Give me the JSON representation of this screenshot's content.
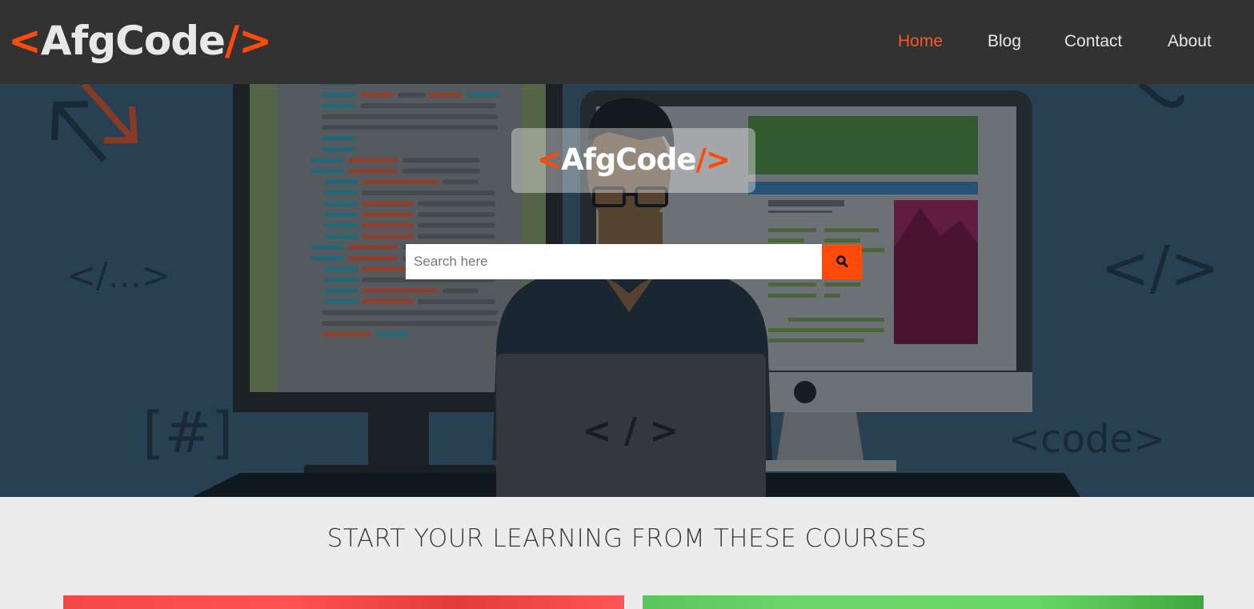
{
  "brand": {
    "open": "<",
    "name": "AfgCode",
    "close": "/>",
    "accent_color": "#ff4a0a"
  },
  "nav": {
    "items": [
      {
        "label": "Home",
        "active": true
      },
      {
        "label": "Blog",
        "active": false
      },
      {
        "label": "Contact",
        "active": false
      },
      {
        "label": "About",
        "active": false
      }
    ]
  },
  "hero": {
    "logo": {
      "open": "<",
      "name": "AfgCode",
      "close": "/>"
    },
    "search": {
      "placeholder": "Search here",
      "value": "",
      "button_icon": "search-icon"
    },
    "decor_texts": [
      "</...>",
      "</>",
      "[#]",
      "<code>",
      "</>"
    ]
  },
  "courses": {
    "title": "START YOUR LEARNING FROM THESE COURSES",
    "cards": [
      {
        "color": "#f44848"
      },
      {
        "color": "#66d766"
      }
    ]
  }
}
